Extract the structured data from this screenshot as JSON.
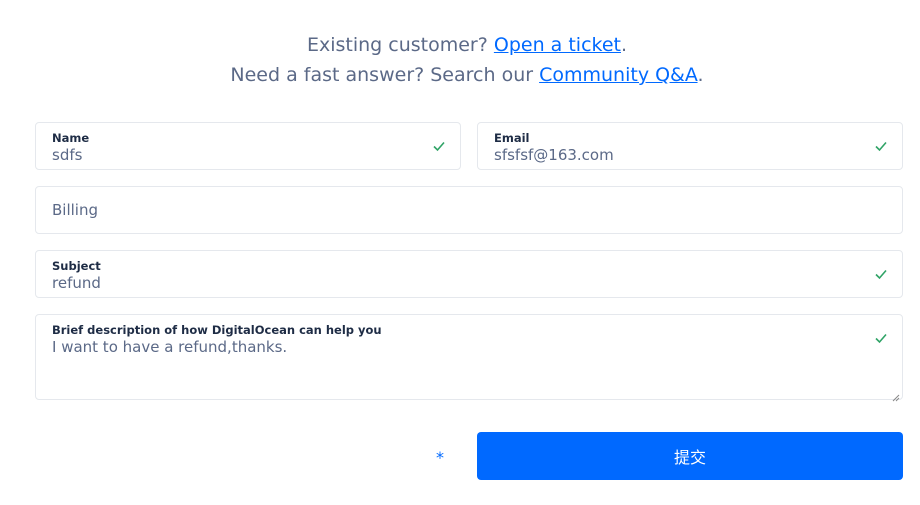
{
  "intro": {
    "line1_prefix": "Existing customer? ",
    "line1_link": "Open a ticket",
    "line1_suffix": ".",
    "line2_prefix": "Need a fast answer? Search our ",
    "line2_link": "Community Q&A",
    "line2_suffix": "."
  },
  "form": {
    "name": {
      "label": "Name",
      "value": "sdfs",
      "valid": true
    },
    "email": {
      "label": "Email",
      "value": "sfsfsf@163.com",
      "valid": true
    },
    "category": {
      "value": "Billing"
    },
    "subject": {
      "label": "Subject",
      "value": "refund",
      "valid": true
    },
    "description": {
      "label": "Brief description of how DigitalOcean can help you",
      "value": "I want to have a refund,thanks.",
      "valid": true
    },
    "required_marker": "*",
    "submit_label": "提交"
  },
  "colors": {
    "accent": "#0069ff",
    "valid_check": "#2fa366",
    "text_muted": "#5b6987",
    "label": "#1e2c45",
    "border": "#e5e8ed"
  },
  "icons": {
    "valid": "check-icon",
    "resize": "resize-handle-icon"
  }
}
